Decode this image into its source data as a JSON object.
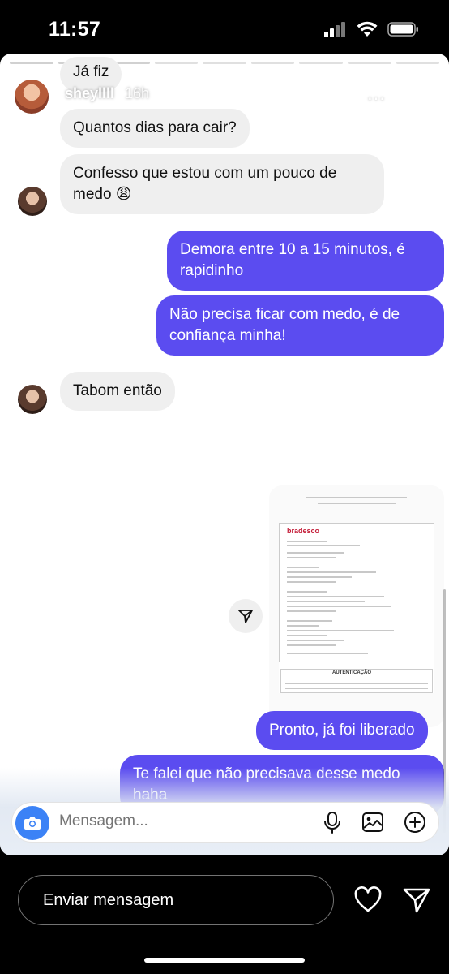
{
  "status_bar": {
    "time": "11:57"
  },
  "story": {
    "user": "sheyllll",
    "age": "16h",
    "more_icon": "…",
    "progress_segments": 9,
    "progress_done": 3
  },
  "chat": {
    "messages": [
      {
        "from": "them",
        "text": "Já fiz"
      },
      {
        "from": "them",
        "text": "Quantos dias para cair?"
      },
      {
        "from": "them",
        "text": "Confesso que estou com um pouco de medo 😩"
      },
      {
        "from": "me",
        "text": "Demora entre 10 a 15 minutos, é rapidinho"
      },
      {
        "from": "me",
        "text": "Não precisa ficar com medo, é de confiança minha!"
      },
      {
        "from": "them",
        "text": "Tabom então"
      },
      {
        "from": "me",
        "text": "Pronto, já foi liberado"
      },
      {
        "from": "me",
        "text": "Te falei que não precisava desse medo haha"
      }
    ],
    "receipt": {
      "brand": "bradesco",
      "footer": "AUTENTICAÇÃO"
    },
    "composer_placeholder": "Mensagem..."
  },
  "footer": {
    "reply_placeholder": "Enviar mensagem"
  },
  "colors": {
    "outgoing": "#5b4cf0",
    "incoming": "#efefef",
    "camera": "#3b82f6"
  }
}
